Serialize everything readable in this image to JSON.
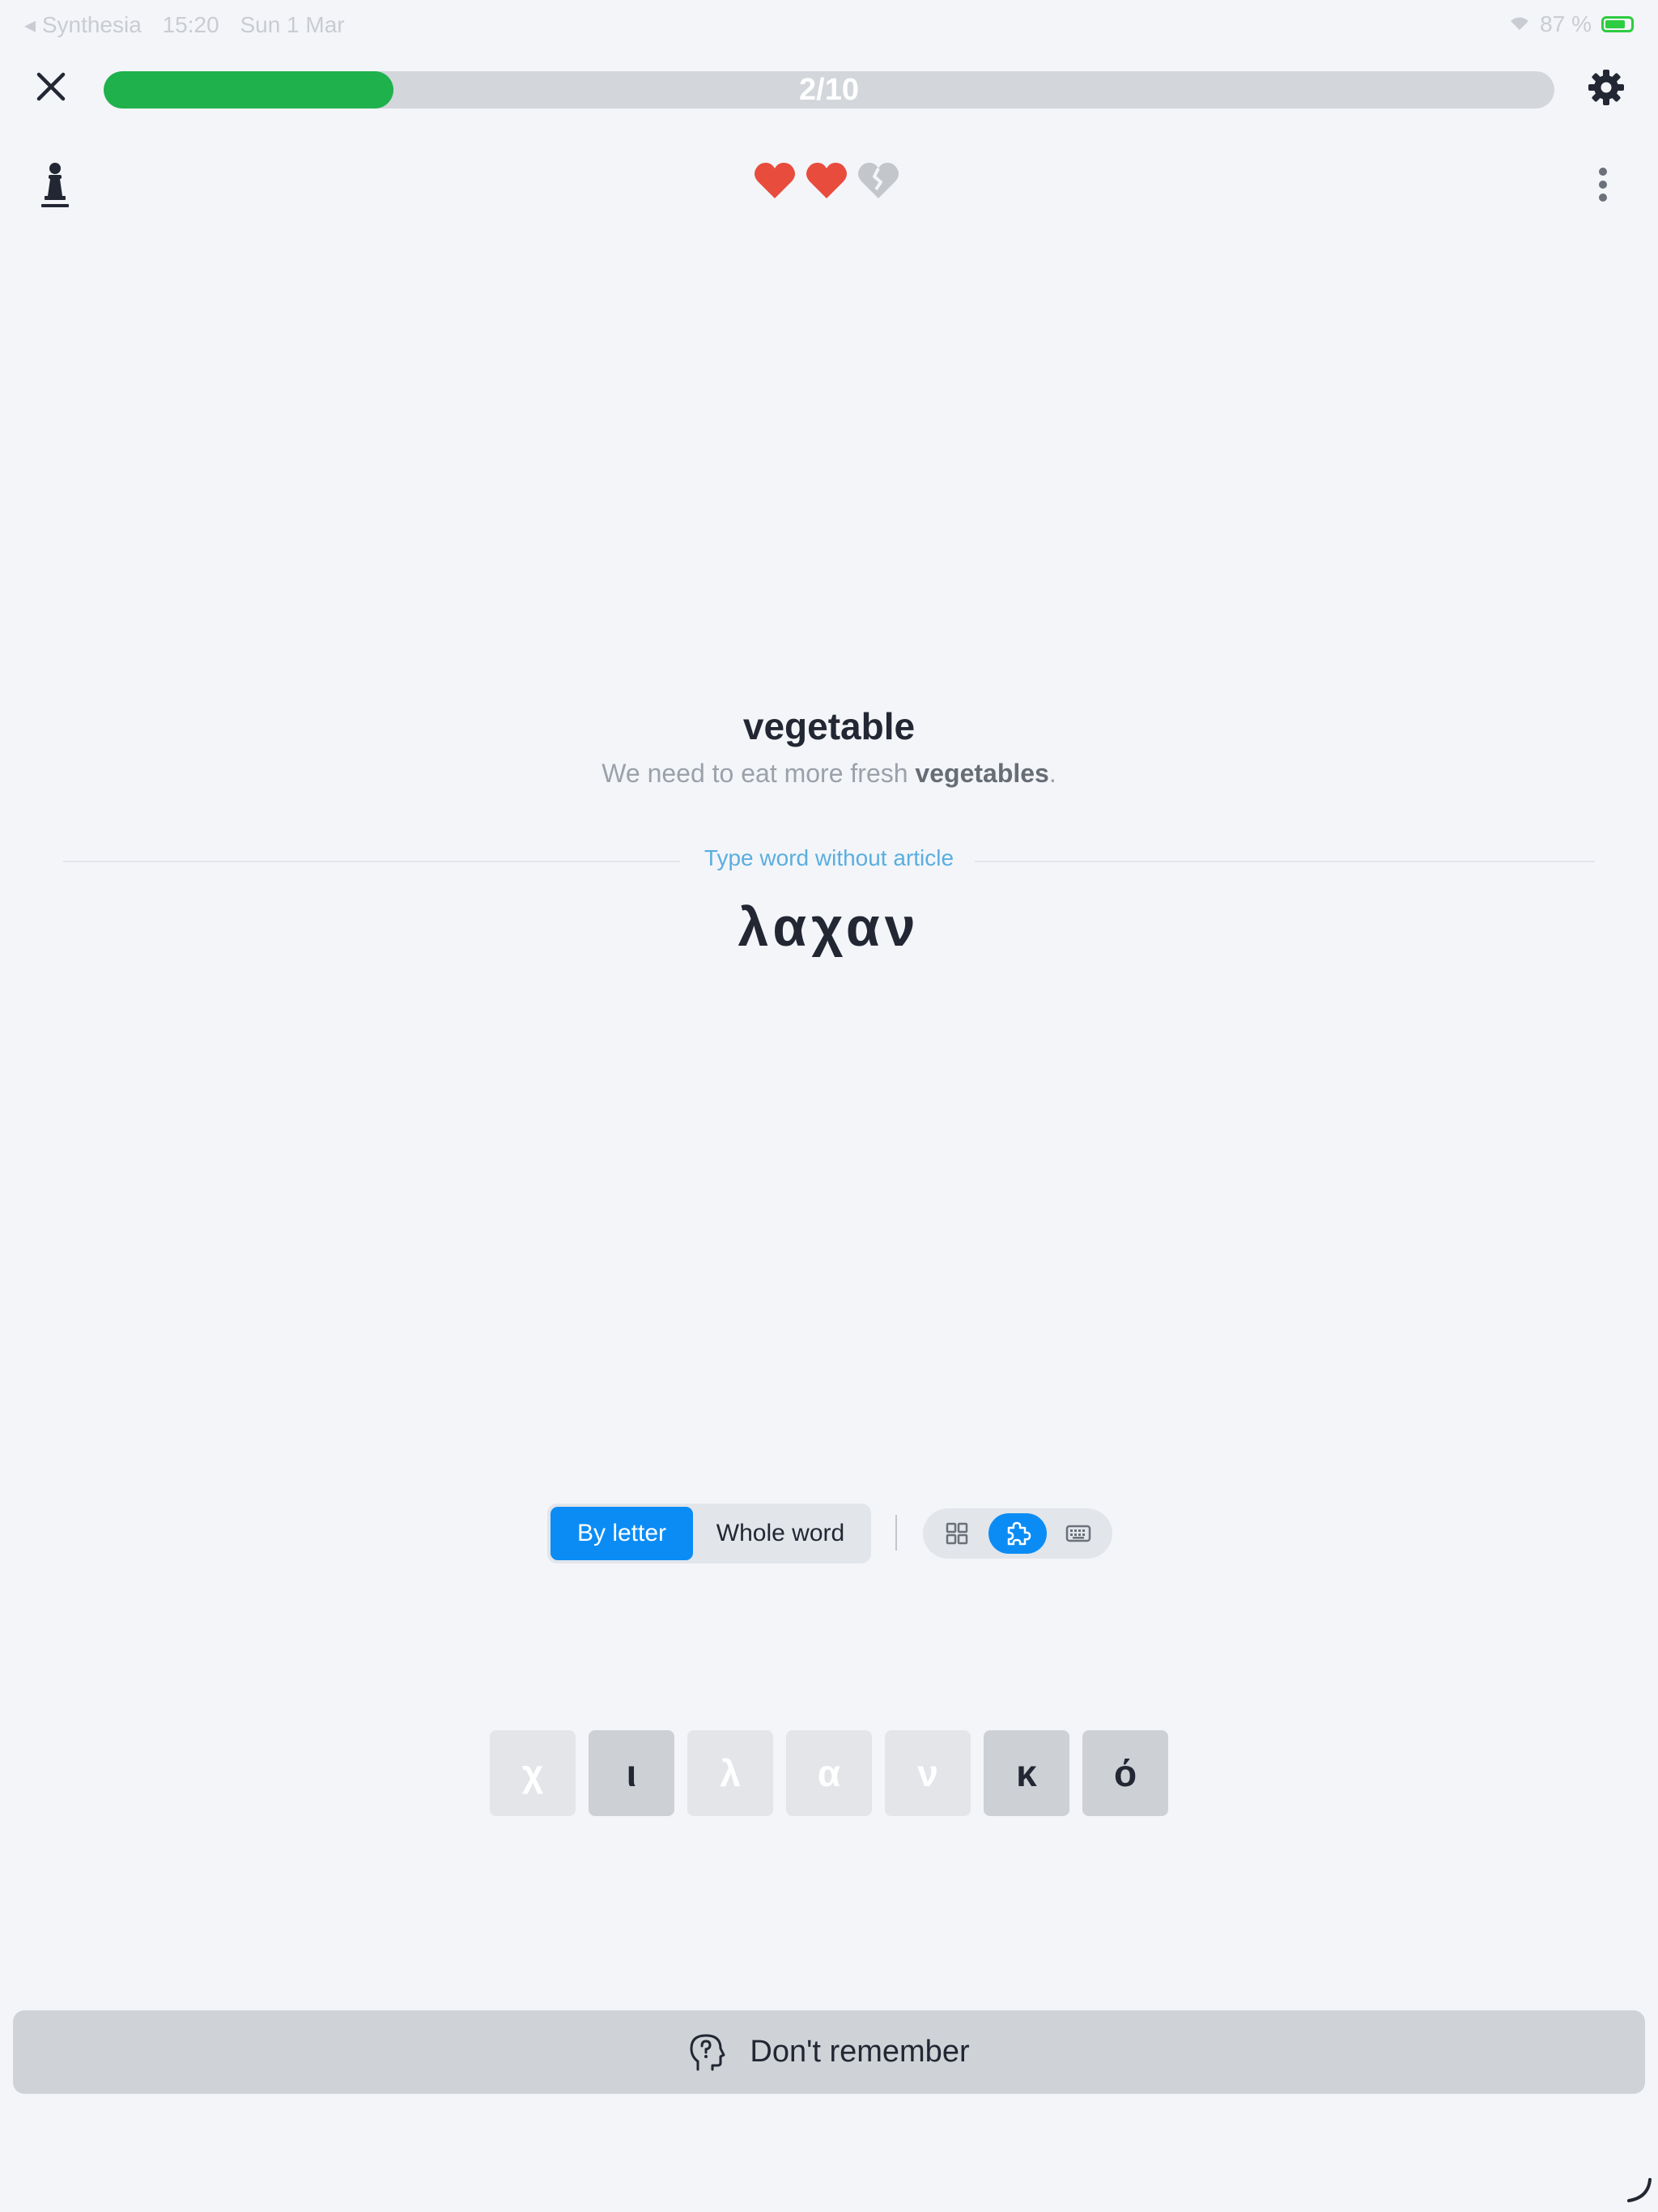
{
  "status_bar": {
    "back_app": "◂ Synthesia",
    "time": "15:20",
    "date": "Sun 1 Mar",
    "battery": "87 %"
  },
  "progress": {
    "label": "2/10",
    "current": 2,
    "total": 10,
    "fill_color": "#1fb14c"
  },
  "lives": {
    "total": 3,
    "remaining": 2,
    "full_color": "#e84c3d",
    "empty_color": "#c3c6cb"
  },
  "card": {
    "word": "vegetable",
    "sentence_before": "We need to eat more fresh ",
    "sentence_highlight": "vegetables",
    "sentence_after": ".",
    "hint": "Type word without article",
    "answer_typed": "λαχαν"
  },
  "mode": {
    "by_letter": "By letter",
    "whole_word": "Whole word",
    "active": "by_letter",
    "input_icons": [
      "grid-icon",
      "puzzle-icon",
      "keyboard-icon"
    ],
    "active_input": "puzzle-icon",
    "accent": "#0b8cf5"
  },
  "tiles": [
    {
      "letter": "χ",
      "state": "used"
    },
    {
      "letter": "ι",
      "state": "available"
    },
    {
      "letter": "λ",
      "state": "used"
    },
    {
      "letter": "α",
      "state": "used"
    },
    {
      "letter": "ν",
      "state": "used"
    },
    {
      "letter": "κ",
      "state": "available"
    },
    {
      "letter": "ό",
      "state": "available"
    }
  ],
  "footer": {
    "dont_remember": "Don't remember"
  }
}
